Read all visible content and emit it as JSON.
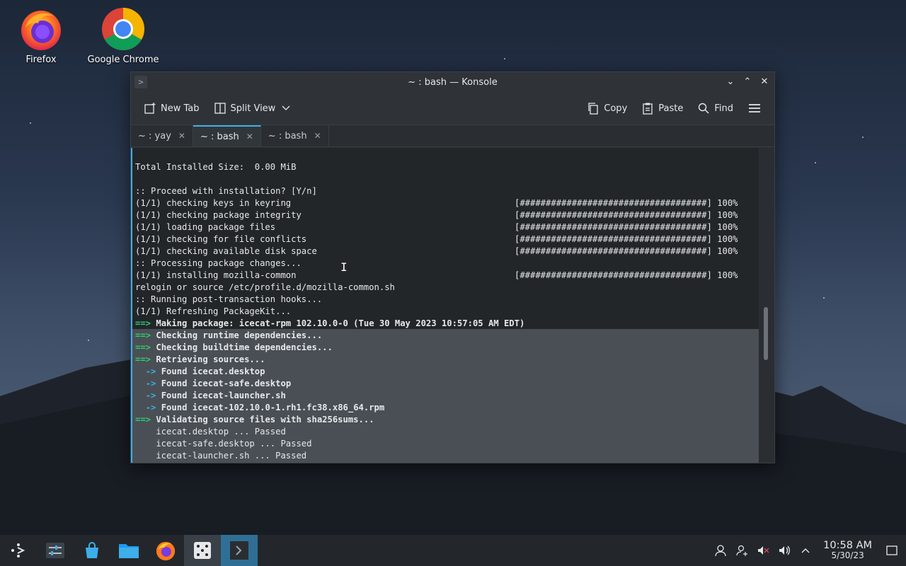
{
  "desktop": {
    "icons": [
      {
        "label": "Firefox"
      },
      {
        "label": "Google Chrome"
      }
    ]
  },
  "window": {
    "title": "~ : bash — Konsole",
    "toolbar": {
      "new_tab": "New Tab",
      "split_view": "Split View",
      "copy": "Copy",
      "paste": "Paste",
      "find": "Find"
    },
    "tabs": [
      {
        "label": "~ : yay",
        "active": false
      },
      {
        "label": "~ : bash",
        "active": true
      },
      {
        "label": "~ : bash",
        "active": false
      }
    ]
  },
  "terminal": {
    "lines": [
      "Total Installed Size:  0.00 MiB",
      "",
      ":: Proceed with installation? [Y/n]",
      "(1/1) checking keys in keyring",
      "(1/1) checking package integrity",
      "(1/1) loading package files",
      "(1/1) checking for file conflicts",
      "(1/1) checking available disk space",
      ":: Processing package changes...",
      "(1/1) installing mozilla-common",
      "relogin or source /etc/profile.d/mozilla-common.sh",
      ":: Running post-transaction hooks...",
      "(1/1) Refreshing PackageKit...",
      "Making package: icecat-rpm 102.10.0-0 (Tue 30 May 2023 10:57:05 AM EDT)",
      "Checking runtime dependencies...",
      "Checking buildtime dependencies...",
      "Retrieving sources...",
      "Found icecat.desktop",
      "Found icecat-safe.desktop",
      "Found icecat-launcher.sh",
      "Found icecat-102.10.0-1.rh1.fc38.x86_64.rpm",
      "Validating source files with sha256sums...",
      "    icecat.desktop ... Passed",
      "    icecat-safe.desktop ... Passed",
      "    icecat-launcher.sh ... Passed"
    ],
    "progress_bar": "[####################################] 100%",
    "arrow_main": "==>",
    "arrow_sub": "->"
  },
  "taskbar": {
    "time": "10:58 AM",
    "date": "5/30/23"
  },
  "colors": {
    "accent": "#3daee9",
    "green": "#2ecc71"
  }
}
